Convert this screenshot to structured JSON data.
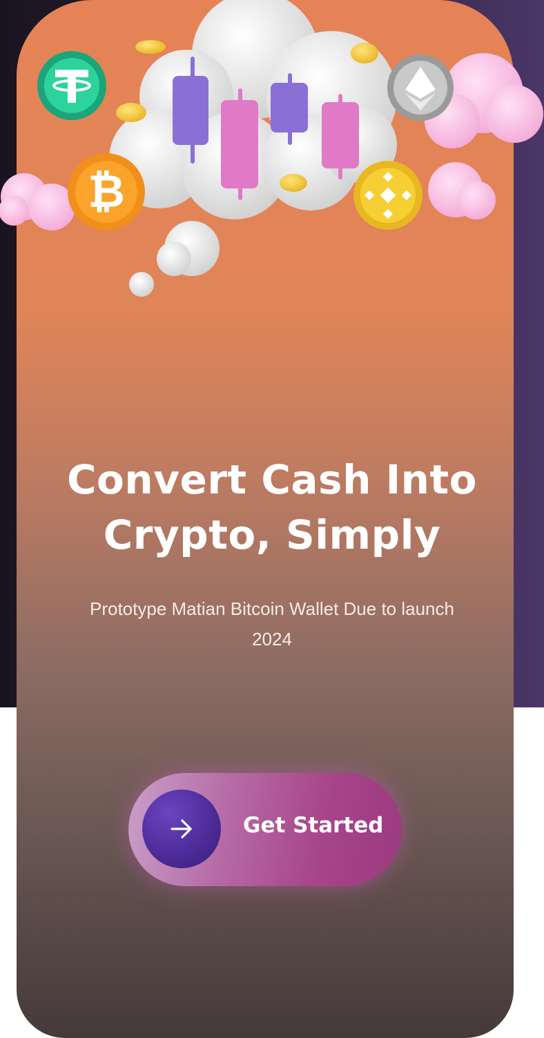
{
  "hero": {
    "headline_line1": "Convert Cash Into",
    "headline_line2": "Crypto, Simply",
    "subtitle": "Prototype Matian Bitcoin Wallet Due to launch 2024"
  },
  "cta": {
    "label": "Get Started",
    "icon": "arrow-right-icon"
  },
  "illustration": {
    "icons": [
      "tether-coin-icon",
      "bitcoin-coin-icon",
      "ethereum-coin-icon",
      "binance-coin-icon",
      "candlestick-chart-icon",
      "cloud-icon"
    ]
  },
  "colors": {
    "card_top": "#e58356",
    "card_bottom": "#45393a",
    "button_accent": "#a7458a",
    "button_circle": "#4e2c9a"
  }
}
